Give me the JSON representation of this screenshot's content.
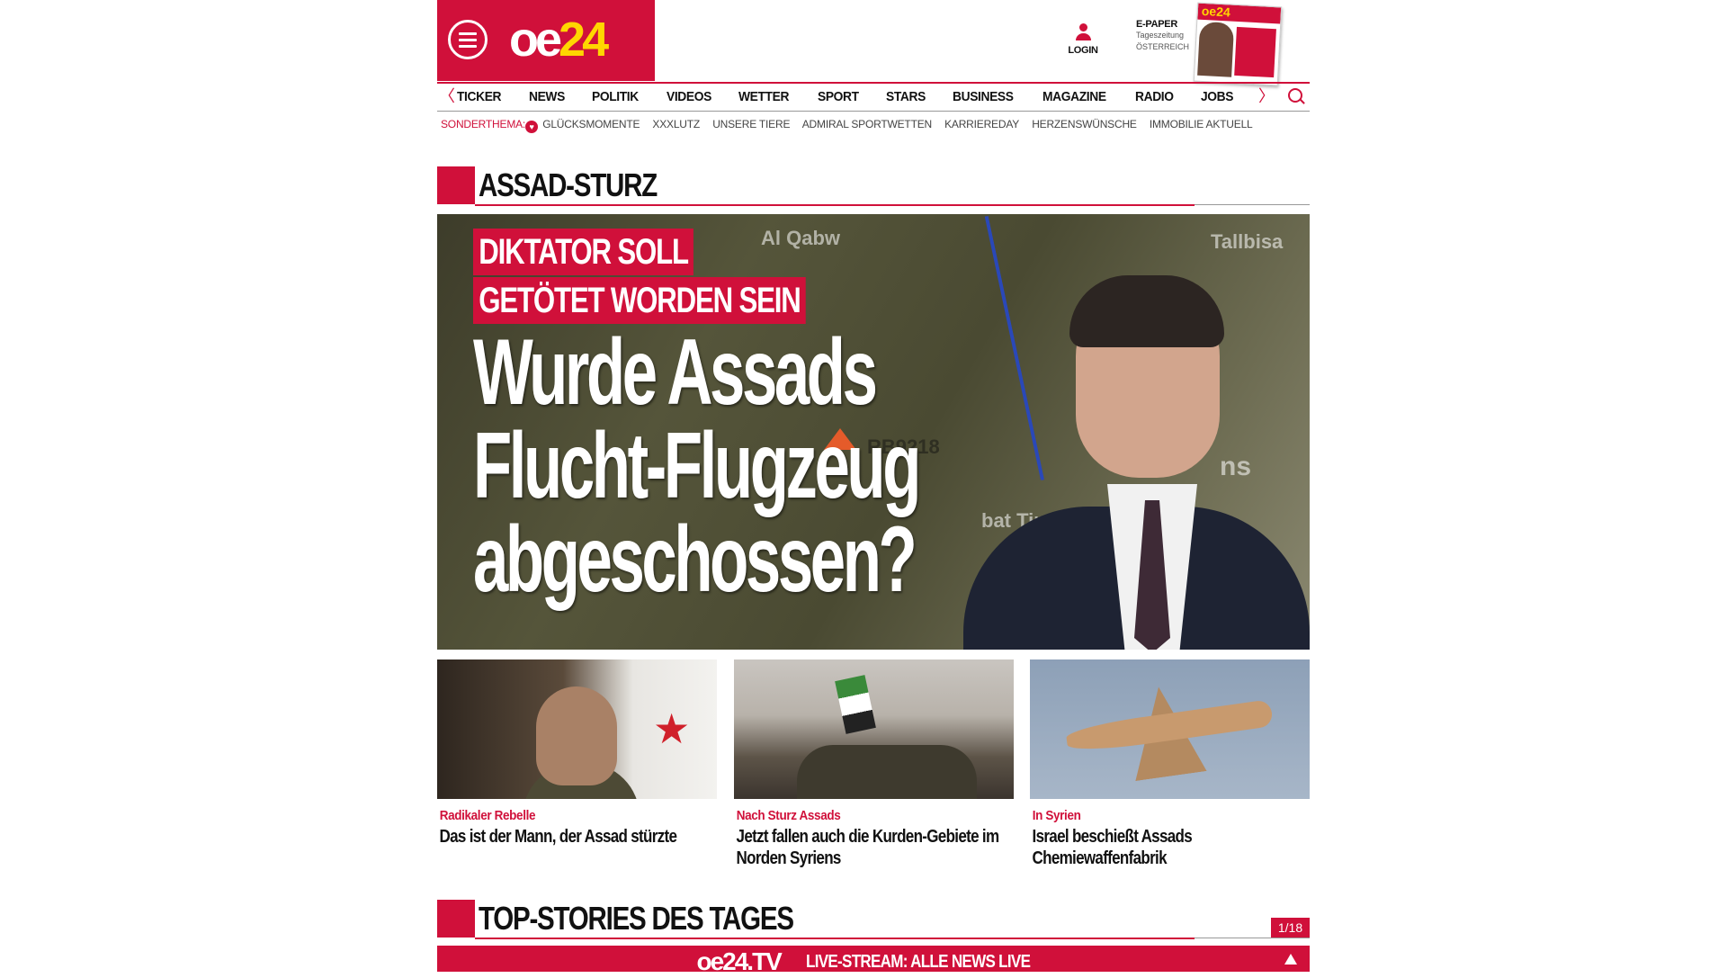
{
  "header": {
    "logo_oe": "oe",
    "logo_num": "24",
    "login_label": "LOGIN",
    "epaper_title": "E-PAPER",
    "epaper_sub1": "Tageszeitung",
    "epaper_sub2": "ÖSTERREICH"
  },
  "nav": {
    "items": [
      "TICKER",
      "NEWS",
      "POLITIK",
      "VIDEOS",
      "WETTER",
      "SPORT",
      "STARS",
      "BUSINESS",
      "MAGAZINE",
      "RADIO",
      "JOBS"
    ],
    "prev_arrow": "〈",
    "next_arrow": "〉"
  },
  "subnav": {
    "label": "SONDERTHEMA:",
    "items": [
      "GLÜCKSMOMENTE",
      "XXXLUTZ",
      "UNSERE TIERE",
      "ADMIRAL SPORTWETTEN",
      "KARRIEREDAY",
      "HERZENSWÜNSCHE",
      "IMMOBILIE AKTUELL"
    ]
  },
  "section1": {
    "title": "ASSAD-STURZ"
  },
  "hero": {
    "kicker_line1": "DIKTATOR SOLL",
    "kicker_line2": "GETÖTET WORDEN SEIN",
    "headline_line1": "Wurde Assads",
    "headline_line2": "Flucht-Flugzeug",
    "headline_line3": "abgeschossen?",
    "map_labels": [
      "Al Qabw",
      "Tallbisa",
      "RB9218",
      "bat Tin Nü",
      "ns"
    ]
  },
  "cards": [
    {
      "kicker": "Radikaler Rebelle",
      "title": "Das ist der Mann, der Assad stürzte"
    },
    {
      "kicker": "Nach Sturz Assads",
      "title": "Jetzt fallen auch die Kurden-Gebiete im Norden Syriens"
    },
    {
      "kicker": "In Syrien",
      "title": "Israel beschießt Assads Chemiewaffenfabrik"
    }
  ],
  "section2": {
    "title": "TOP-STORIES DES TAGES",
    "counter": "1/18"
  },
  "livebar": {
    "brand": "oe24.TV",
    "text": "LIVE-STREAM: ALLE NEWS LIVE"
  },
  "colors": {
    "brand_red": "#d0103a",
    "logo_yellow": "#ffd600"
  }
}
